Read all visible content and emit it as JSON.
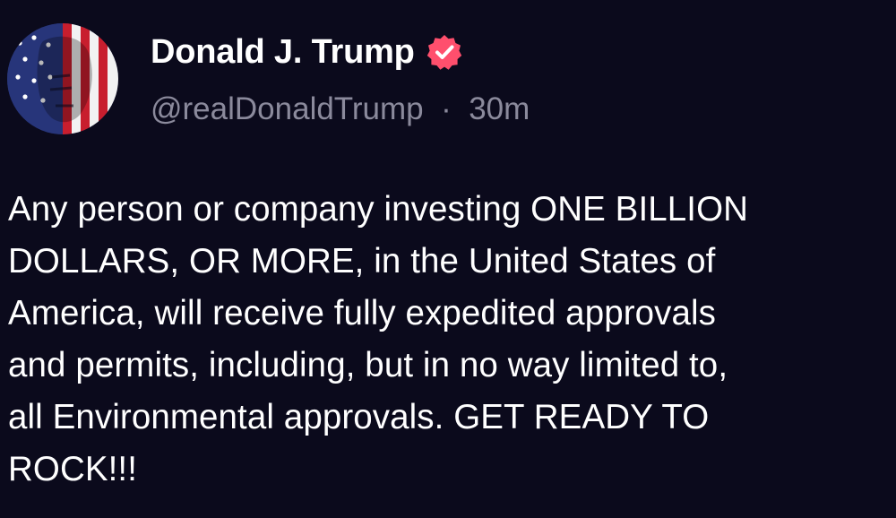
{
  "post": {
    "author": {
      "display_name": "Donald J. Trump",
      "handle": "@realDonaldTrump",
      "separator": "·",
      "timestamp": "30m",
      "verified": true,
      "verified_badge_color": "#ff4f6d",
      "avatar": "avatar-flag-portrait"
    },
    "body_lines": [
      "Any person or company investing ONE BILLION",
      "DOLLARS, OR MORE, in the United States of",
      "America, will receive fully expedited approvals",
      "and permits, including, but in no way limited to,",
      "all Environmental approvals. GET READY TO",
      "ROCK!!!"
    ]
  },
  "colors": {
    "background": "#0b0a1c",
    "text_primary": "#ffffff",
    "text_secondary": "#8b8a9c"
  }
}
